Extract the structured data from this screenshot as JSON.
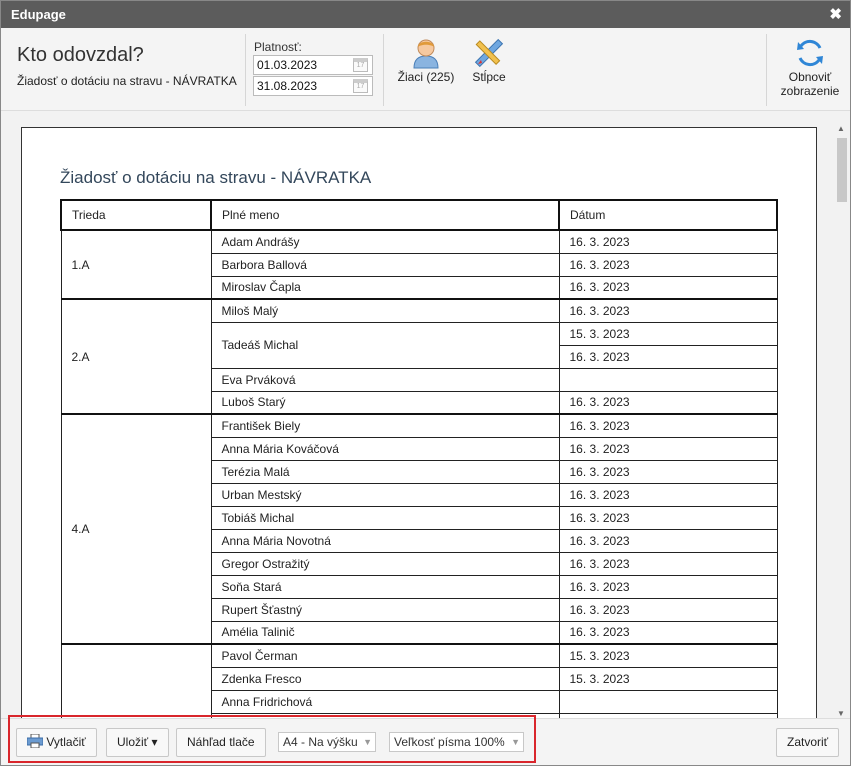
{
  "window": {
    "title": "Edupage",
    "close_glyph": "✖"
  },
  "header": {
    "title": "Kto odovzdal?",
    "subtitle": "Žiadosť o dotáciu na stravu - NÁVRATKA",
    "platnost_label": "Platnosť:",
    "date_from": "01.03.2023",
    "date_to": "31.08.2023",
    "students_label": "Žiaci (225)",
    "columns_label": "Stĺpce",
    "refresh_label_1": "Obnoviť",
    "refresh_label_2": "zobrazenie"
  },
  "report": {
    "title": "Žiadosť o dotáciu na stravu - NÁVRATKA",
    "headers": {
      "class": "Trieda",
      "name": "Plné meno",
      "date": "Dátum"
    },
    "groups": [
      {
        "class": "1.A",
        "rows": [
          {
            "name": "Adam Andrášy",
            "dates": [
              "16. 3. 2023"
            ]
          },
          {
            "name": "Barbora Ballová",
            "dates": [
              "16. 3. 2023"
            ]
          },
          {
            "name": "Miroslav Čapla",
            "dates": [
              "16. 3. 2023"
            ]
          }
        ]
      },
      {
        "class": "2.A",
        "rows": [
          {
            "name": "Miloš Malý",
            "dates": [
              "16. 3. 2023"
            ]
          },
          {
            "name": "Tadeáš Michal",
            "dates": [
              "15. 3. 2023",
              "16. 3. 2023"
            ]
          },
          {
            "name": "Eva Prváková",
            "dates": [
              ""
            ]
          },
          {
            "name": "Luboš Starý",
            "dates": [
              "16. 3. 2023"
            ]
          }
        ]
      },
      {
        "class": "4.A",
        "rows": [
          {
            "name": "František Biely",
            "dates": [
              "16. 3. 2023"
            ]
          },
          {
            "name": "Anna Mária Kováčová",
            "dates": [
              "16. 3. 2023"
            ]
          },
          {
            "name": "Terézia Malá",
            "dates": [
              "16. 3. 2023"
            ]
          },
          {
            "name": "Urban Mestský",
            "dates": [
              "16. 3. 2023"
            ]
          },
          {
            "name": "Tobiáš Michal",
            "dates": [
              "16. 3. 2023"
            ]
          },
          {
            "name": "Anna Mária Novotná",
            "dates": [
              "16. 3. 2023"
            ]
          },
          {
            "name": "Gregor Ostražitý",
            "dates": [
              "16. 3. 2023"
            ]
          },
          {
            "name": "Soňa Stará",
            "dates": [
              "16. 3. 2023"
            ]
          },
          {
            "name": "Rupert Šťastný",
            "dates": [
              "16. 3. 2023"
            ]
          },
          {
            "name": "Amélia Talinič",
            "dates": [
              "16. 3. 2023"
            ]
          }
        ]
      },
      {
        "class": "",
        "rows": [
          {
            "name": "Pavol Čerman",
            "dates": [
              "15. 3. 2023"
            ]
          },
          {
            "name": "Zdenka Fresco",
            "dates": [
              "15. 3. 2023"
            ]
          },
          {
            "name": "Anna Fridrichová",
            "dates": [
              ""
            ]
          },
          {
            "name": "",
            "dates": [
              ""
            ]
          }
        ]
      }
    ]
  },
  "footer": {
    "print_label": "Vytlačiť",
    "save_label": "Uložiť ▾",
    "preview_label": "Náhľad tlače",
    "paper_select": "A4 - Na výšku",
    "font_select": "Veľkosť písma 100%",
    "close_label": "Zatvoriť"
  },
  "colors": {
    "titlebar": "#5c5c5c",
    "highlight": "#d9262c",
    "accent_blue": "#2f86d6"
  }
}
